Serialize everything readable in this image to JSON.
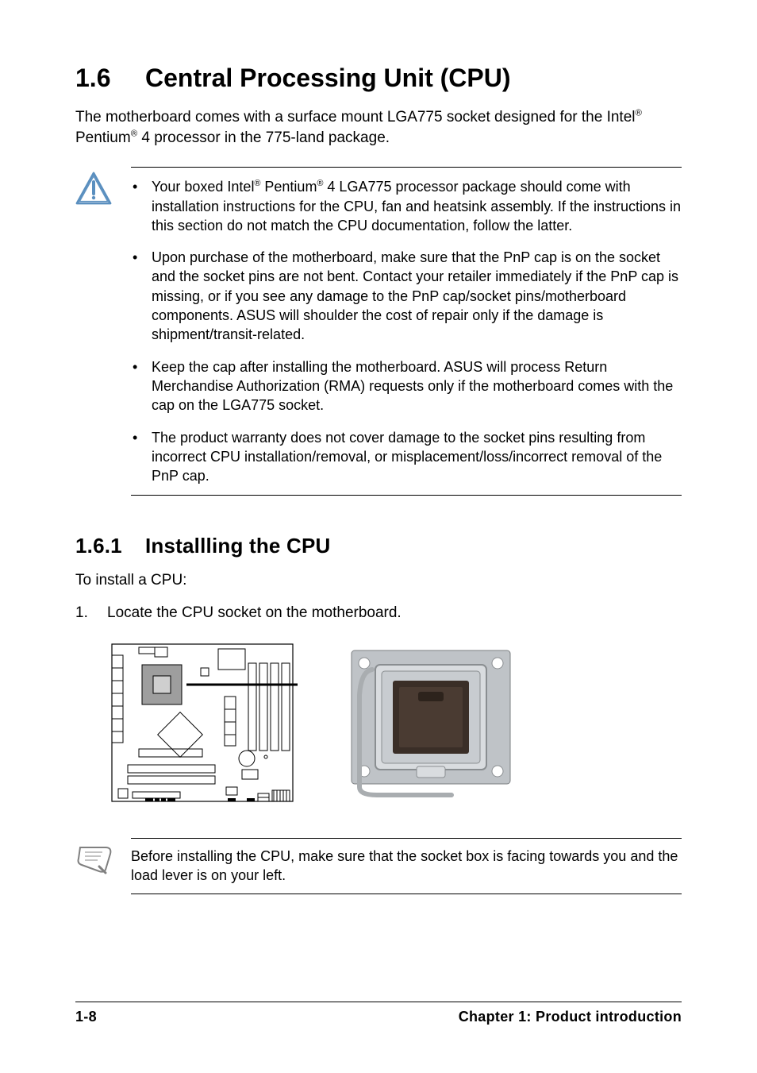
{
  "section_number": "1.6",
  "section_title": "Central Processing Unit (CPU)",
  "intro_html": "The motherboard comes with a surface mount LGA775 socket designed for the Intel<sup>®</sup> Pentium<sup>®</sup> 4 processor in the 775-land package.",
  "warnings": [
    "Your boxed Intel<sup>®</sup> Pentium<sup>®</sup> 4 LGA775 processor package should come with installation instructions for the CPU, fan and heatsink assembly. If the instructions in this section do not match the CPU documentation, follow the latter.",
    "Upon purchase of the motherboard, make sure that the PnP cap is on the socket and the socket pins are not bent. Contact your retailer immediately if the PnP cap is missing, or if you see any damage to the PnP cap/socket pins/motherboard components. ASUS will shoulder the cost of repair only if the damage is shipment/transit-related.",
    "Keep the cap after installing the motherboard. ASUS will process Return Merchandise Authorization (RMA) requests only if the motherboard comes with the cap on the LGA775 socket.",
    "The product warranty does not cover damage to the socket pins resulting from incorrect CPU installation/removal, or misplacement/loss/incorrect removal of the PnP cap."
  ],
  "subsection_number": "1.6.1",
  "subsection_title": "Installling the CPU",
  "subsection_intro": "To install a CPU:",
  "step_number": "1.",
  "step_text": "Locate the CPU socket on the motherboard.",
  "tip": "Before installing the CPU, make sure that the socket box is facing towards you and the load lever is on your left.",
  "footer_left": "1-8",
  "footer_right": "Chapter 1: Product introduction"
}
